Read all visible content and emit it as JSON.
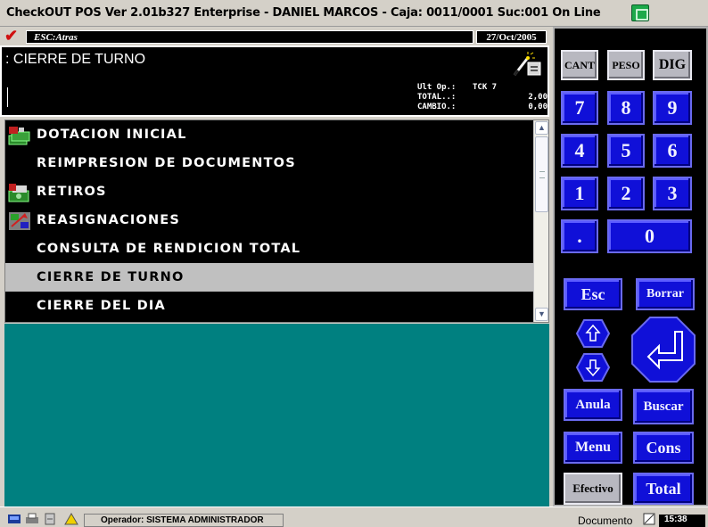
{
  "window": {
    "title": "CheckOUT POS Ver 2.01b327 Enterprise - DANIEL MARCOS - Caja: 0011/0001 Suc:001  On Line",
    "icon": "green-terminal-icon"
  },
  "topbar": {
    "esc_label": "ESC:Atras",
    "date": "27/Oct/2005"
  },
  "header": {
    "screen_title": ": CIERRE DE TURNO",
    "info": [
      {
        "label": "Ult Op.:",
        "value": "TCK 7"
      },
      {
        "label": "TOTAL..:",
        "value": "2,00"
      },
      {
        "label": "CAMBIO.:",
        "value": "0,00"
      }
    ]
  },
  "menu": {
    "items": [
      {
        "label": "DOTACION INICIAL",
        "icon": "money-stack-icon",
        "selected": false
      },
      {
        "label": "REIMPRESION DE DOCUMENTOS",
        "icon": "",
        "selected": false
      },
      {
        "label": "RETIROS",
        "icon": "cash-withdraw-icon",
        "selected": false
      },
      {
        "label": "REASIGNACIONES",
        "icon": "reassign-icon",
        "selected": false
      },
      {
        "label": "CONSULTA DE RENDICION TOTAL",
        "icon": "",
        "selected": false
      },
      {
        "label": "CIERRE DE TURNO",
        "icon": "",
        "selected": true
      },
      {
        "label": "CIERRE DEL DIA",
        "icon": "",
        "selected": false
      }
    ]
  },
  "keypad": {
    "cant": "CANT",
    "peso": "PESO",
    "dig": "DIG",
    "n7": "7",
    "n8": "8",
    "n9": "9",
    "n4": "4",
    "n5": "5",
    "n6": "6",
    "n1": "1",
    "n2": "2",
    "n3": "3",
    "dot": ".",
    "n0": "0",
    "esc": "Esc",
    "borrar": "Borrar",
    "anula": "Anula",
    "buscar": "Buscar",
    "menu": "Menu",
    "cons": "Cons",
    "efectivo": "Efectivo",
    "total": "Total"
  },
  "statusbar": {
    "operator": "Operador: SISTEMA ADMINISTRADOR",
    "documento": "Documento",
    "time": "15:38"
  },
  "colors": {
    "teal": "#008080",
    "key_blue": "#1010d8",
    "selected_row": "#c0c0c0"
  }
}
